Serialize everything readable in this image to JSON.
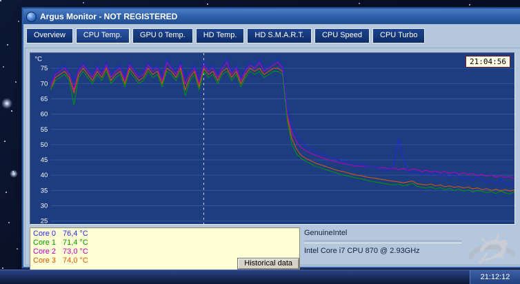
{
  "window": {
    "title": "Argus Monitor - NOT REGISTERED",
    "active_tab": "CPU Temp.",
    "tabs": [
      {
        "label": "Overview"
      },
      {
        "label": "CPU Temp."
      },
      {
        "label": "GPU 0 Temp."
      },
      {
        "label": "HD Temp."
      },
      {
        "label": "HD S.M.A.R.T."
      },
      {
        "label": "CPU Speed"
      },
      {
        "label": "CPU Turbo"
      }
    ]
  },
  "chart": {
    "clock": "21:04:56"
  },
  "legend": {
    "button_label": "Historical data"
  },
  "cpu_info": {
    "vendor": "GenuineIntel",
    "model": "Intel Core i7 CPU 870 @ 2.93GHz"
  },
  "taskbar": {
    "time": "21:12:12"
  },
  "chart_data": {
    "type": "line",
    "title": "",
    "ylabel": "°C",
    "ylim": [
      24,
      80
    ],
    "yticks": [
      75,
      70,
      65,
      60,
      55,
      50,
      45,
      40,
      35,
      30,
      25
    ],
    "x_range": [
      0,
      100
    ],
    "cursor_x": 33,
    "grid": "horizontal",
    "legend_position": "bottom-left",
    "series": [
      {
        "name": "Core 0",
        "color": "#2424dd",
        "current": "76,4 °C",
        "values": [
          70,
          74,
          75,
          76,
          74,
          71,
          75,
          77,
          75,
          73,
          76,
          74,
          77,
          73,
          75,
          76,
          72,
          77,
          75,
          73,
          74,
          77,
          75,
          76,
          72,
          78,
          76,
          74,
          77,
          72,
          74,
          76,
          71,
          77,
          75,
          76,
          73,
          76,
          78,
          74,
          76,
          72,
          75,
          77,
          76,
          78,
          75,
          76,
          77,
          78,
          76,
          62,
          56,
          53,
          51,
          49.5,
          48.5,
          48,
          47,
          46.5,
          46,
          45.5,
          45,
          44.5,
          44.8,
          44,
          43.5,
          43.8,
          43,
          42.5,
          42.8,
          42,
          41.5,
          41.8,
          43.5,
          52,
          45.5,
          41.5,
          40.8,
          40.9,
          40.2,
          40.6,
          40.1,
          40.8,
          39.8,
          40.3,
          39.2,
          40.6,
          39.5,
          38.6,
          39.2,
          38.2,
          39.6,
          38.4,
          37.6,
          38.2,
          37.2,
          38.6,
          37.4,
          36.6,
          37.5
        ]
      },
      {
        "name": "Core 1",
        "color": "#009600",
        "current": "71,4 °C",
        "values": [
          68,
          71,
          72,
          73,
          71,
          63,
          72,
          74,
          72,
          70,
          73,
          71,
          74,
          70,
          72,
          73,
          69,
          74,
          72,
          70,
          71,
          74,
          72,
          73,
          69,
          74,
          73,
          71,
          74,
          66,
          71,
          73,
          68,
          74,
          72,
          73,
          70,
          73,
          74,
          71,
          73,
          69,
          72,
          74,
          73,
          74,
          72,
          73,
          74,
          74,
          73,
          58,
          50,
          47,
          45.5,
          44.5,
          43.8,
          43,
          42.5,
          42,
          41.5,
          41,
          40.5,
          40,
          39.8,
          39.4,
          39,
          38.8,
          38.4,
          38,
          37.8,
          37.5,
          37.2,
          37,
          36.8,
          37.1,
          36.5,
          36.8,
          37.4,
          36.4,
          36,
          35.8,
          36.2,
          35.5,
          36,
          35.2,
          35.7,
          35,
          35.5,
          34.8,
          35.2,
          34.5,
          35,
          34.7,
          34.2,
          34.6,
          34,
          34.8,
          34.2,
          33.8,
          34.6
        ]
      },
      {
        "name": "Core 2",
        "color": "#bb00bb",
        "current": "73,0 °C",
        "values": [
          69,
          73,
          74,
          75,
          73,
          68,
          74,
          76,
          74,
          72,
          75,
          73,
          76,
          72,
          74,
          75,
          71,
          76,
          74,
          72,
          73,
          76,
          74,
          75,
          71,
          77,
          75,
          73,
          76,
          70,
          73,
          75,
          70,
          76,
          74,
          75,
          72,
          75,
          77,
          73,
          75,
          71,
          74,
          76,
          75,
          77,
          74,
          75,
          76,
          77,
          75,
          60,
          54,
          51,
          49,
          48,
          47.2,
          46.6,
          46,
          45.5,
          45,
          44.6,
          44.2,
          43.8,
          43.5,
          43.2,
          43,
          42.8,
          43.1,
          42.5,
          42.8,
          42.2,
          42.6,
          42,
          42.4,
          41.8,
          42.2,
          41.6,
          42,
          41.8,
          41.2,
          41.6,
          41,
          41.4,
          40.8,
          41.2,
          40.6,
          41,
          40.4,
          40.8,
          40.2,
          40.6,
          39.8,
          40.3,
          39.6,
          40,
          39.4,
          39.8,
          39.2,
          39.6,
          38.8
        ]
      },
      {
        "name": "Core 3",
        "color": "#dd5500",
        "current": "74,0 °C",
        "values": [
          68,
          72,
          73,
          74,
          72,
          67,
          73,
          75,
          73,
          71,
          74,
          72,
          75,
          71,
          73,
          74,
          70,
          75,
          73,
          71,
          72,
          75,
          73,
          74,
          70,
          75,
          74,
          72,
          75,
          68,
          72,
          74,
          69,
          75,
          73,
          74,
          71,
          74,
          75,
          72,
          74,
          70,
          73,
          75,
          74,
          75,
          73,
          74,
          75,
          75,
          74,
          59,
          52,
          48.5,
          46.5,
          45.5,
          44.8,
          44,
          43.5,
          43,
          42.5,
          42,
          41.5,
          41.2,
          40.8,
          40.4,
          40,
          39.8,
          39.4,
          39.2,
          39,
          38.7,
          38.5,
          38.2,
          38,
          37.8,
          37.5,
          37.8,
          38.1,
          37.2,
          37,
          36.8,
          37.1,
          36.5,
          36.8,
          36.2,
          36.5,
          36,
          36.3,
          35.8,
          36.1,
          35.5,
          35.8,
          35.3,
          35.6,
          35,
          35.4,
          34.9,
          35.3,
          34.8,
          35.2
        ]
      }
    ]
  }
}
